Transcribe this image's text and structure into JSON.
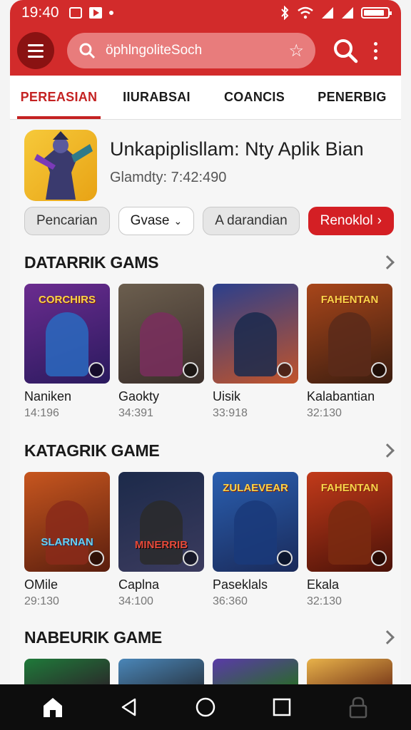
{
  "status": {
    "time": "19:40"
  },
  "search": {
    "placeholder": "öphlngolit­eSoch"
  },
  "tabs": [
    "PEREASIAN",
    "IIURABSAI",
    "COANCIS",
    "PENERBIG"
  ],
  "feature": {
    "title": "Unkapiplisllam: Nty Aplik Bian",
    "subtitle": "Glamdty:  7:42:490"
  },
  "chips": [
    "Pencarian",
    "Gvase",
    "A darandian",
    "Renoklol"
  ],
  "sections": [
    {
      "title": "DATARRIK GAMS",
      "cards": [
        {
          "name": "Naniken",
          "meta": "14:196",
          "logo": "CORCHIRS",
          "colors": [
            "#6b2c8f",
            "#2a1a5e"
          ]
        },
        {
          "name": "Gaokty",
          "meta": "34:391",
          "logo": "",
          "colors": [
            "#6b5e4e",
            "#3a2e2a"
          ]
        },
        {
          "name": "Uisik",
          "meta": "33:918",
          "logo": "",
          "colors": [
            "#2b3f8c",
            "#c2542a"
          ]
        },
        {
          "name": "Kalabantian",
          "meta": "32:130",
          "logo": "FAHENTAN",
          "colors": [
            "#a8461a",
            "#3b1d10"
          ]
        }
      ]
    },
    {
      "title": "KATAGRIK GAME",
      "cards": [
        {
          "name": "OMile",
          "meta": "29:130",
          "logo": "SLARNAN",
          "colors": [
            "#c7561f",
            "#5a1e0e"
          ]
        },
        {
          "name": "Caplna",
          "meta": "34:100",
          "logo": "MINERRIB",
          "colors": [
            "#1c2a4a",
            "#3b3b5e"
          ]
        },
        {
          "name": "Paseklals",
          "meta": "36:360",
          "logo": "ZULAEVEAR",
          "colors": [
            "#2a5fb0",
            "#1a2a5a"
          ]
        },
        {
          "name": "Ekala",
          "meta": "32:130",
          "logo": "FAHENTAN",
          "colors": [
            "#c23a1a",
            "#4a1208"
          ]
        }
      ]
    },
    {
      "title": "NABEURIK GAME",
      "cards": [
        {
          "colors": [
            "#1f7a3a",
            "#2a2a2a"
          ]
        },
        {
          "colors": [
            "#4a86b8",
            "#2a3a4a"
          ]
        },
        {
          "colors": [
            "#5a3aa8",
            "#2a6a2a"
          ]
        },
        {
          "colors": [
            "#e8b24a",
            "#7a3a1a"
          ]
        }
      ]
    }
  ],
  "colors": {
    "accent": "#d22b2b",
    "accent_dark": "#8a1212",
    "chip_red": "#d41f24"
  },
  "icons": [
    "menu-icon",
    "search-icon",
    "star-icon",
    "more-vert-icon",
    "chevron-right-icon",
    "home-icon",
    "back-icon",
    "circle-home-icon",
    "recents-icon",
    "lock-icon"
  ]
}
